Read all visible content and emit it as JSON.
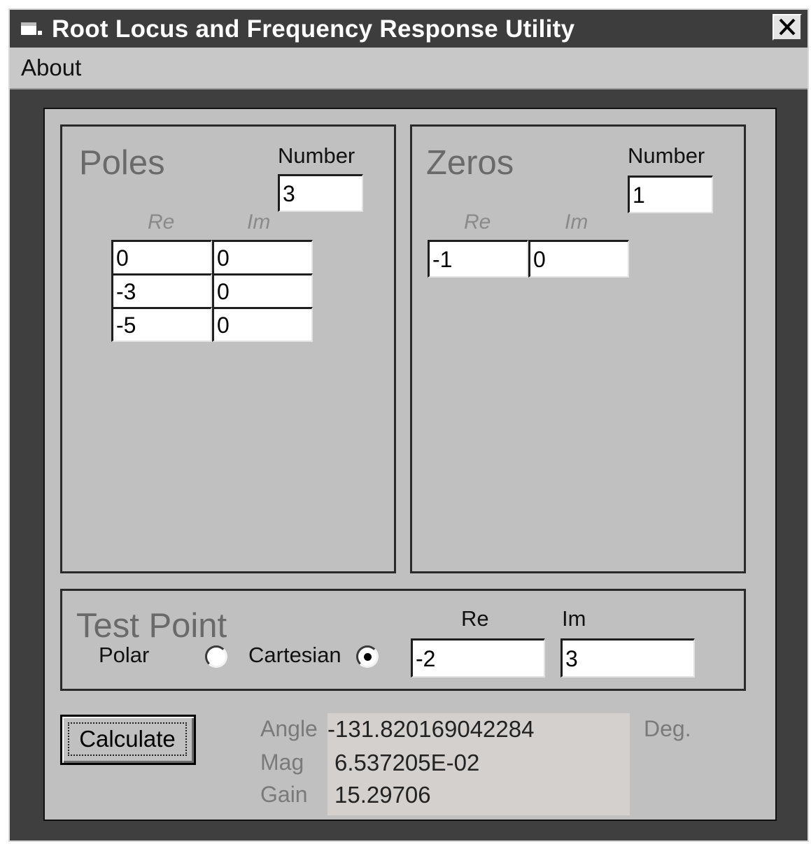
{
  "window": {
    "title": "Root Locus and Frequency Response Utility",
    "icons": {
      "app": "app-window-icon",
      "close": "close-x-icon"
    },
    "colors": {
      "titlebar": "#3d3d3d",
      "surface": "#c0c0c0",
      "result_panel": "#d3d0ce"
    }
  },
  "menu": {
    "about": "About"
  },
  "poles": {
    "title": "Poles",
    "number_label": "Number",
    "number": "3",
    "re_label": "Re",
    "im_label": "Im",
    "rows": [
      {
        "re": "0",
        "im": "0"
      },
      {
        "re": "-3",
        "im": "0"
      },
      {
        "re": "-5",
        "im": "0"
      }
    ]
  },
  "zeros": {
    "title": "Zeros",
    "number_label": "Number",
    "number": "1",
    "re_label": "Re",
    "im_label": "Im",
    "rows": [
      {
        "re": "-1",
        "im": "0"
      }
    ]
  },
  "test_point": {
    "title": "Test Point",
    "polar_label": "Polar",
    "cartesian_label": "Cartesian",
    "selected_mode": "Cartesian",
    "re_label": "Re",
    "im_label": "Im",
    "re": "-2",
    "im": "3"
  },
  "calculate_label": "Calculate",
  "results": {
    "angle_label": "Angle",
    "angle": "-131.820169042284",
    "angle_unit": "Deg.",
    "mag_label": "Mag",
    "mag": "6.537205E-02",
    "gain_label": "Gain",
    "gain": "15.29706"
  }
}
